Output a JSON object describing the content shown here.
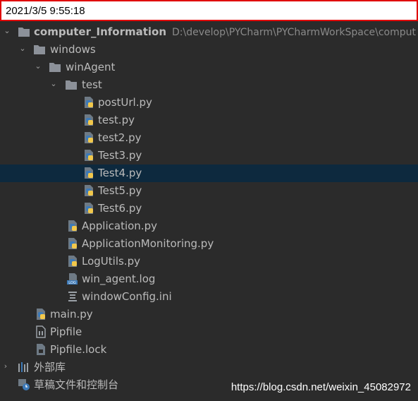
{
  "timestamp": "2021/3/5 9:55:18",
  "tree": {
    "project_name": "computer_Information",
    "project_path": "D:\\develop\\PYCharm\\PYCharmWorkSpace\\comput",
    "windows": "windows",
    "winAgent": "winAgent",
    "test": "test",
    "test_files": [
      "postUrl.py",
      "test.py",
      "test2.py",
      "Test3.py",
      "Test4.py",
      "Test5.py",
      "Test6.py"
    ],
    "selected_file": "Test4.py",
    "winAgent_files": [
      "Application.py",
      "ApplicationMonitoring.py",
      "LogUtils.py",
      "win_agent.log",
      "windowConfig.ini"
    ],
    "root_files": [
      "main.py",
      "Pipfile",
      "Pipfile.lock"
    ],
    "external_libraries": "外部库",
    "scratches": "草稿文件和控制台"
  },
  "watermark": "https://blog.csdn.net/weixin_45082972",
  "colors": {
    "background": "#2b2b2b",
    "selection": "#0d293e",
    "text": "#bbbbbb",
    "folder": "#8c9199",
    "python_blue": "#3d7ab8",
    "python_yellow": "#f2c84b"
  }
}
